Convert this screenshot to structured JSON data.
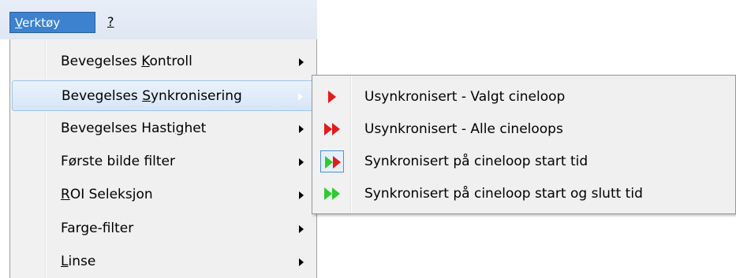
{
  "menubar": {
    "tools_label_prefix": "",
    "tools_label_ul": "V",
    "tools_label_rest": "erktøy",
    "help_label": "?"
  },
  "menu": {
    "items": [
      {
        "pre": "Bevegelses ",
        "ul": "K",
        "post": "ontroll",
        "has_submenu": true,
        "highlighted": false
      },
      {
        "pre": "Bevegelses ",
        "ul": "S",
        "post": "ynkronisering",
        "has_submenu": true,
        "highlighted": true
      },
      {
        "pre": "Bevegelses Hasti",
        "ul": "g",
        "post": "het",
        "has_submenu": true,
        "highlighted": false
      },
      {
        "pre": "Første bilde filter",
        "ul": "",
        "post": "",
        "has_submenu": true,
        "highlighted": false
      },
      {
        "pre": "",
        "ul": "R",
        "post": "OI Seleksjon",
        "has_submenu": true,
        "highlighted": false
      },
      {
        "pre": "Farge-filter",
        "ul": "",
        "post": "",
        "has_submenu": true,
        "highlighted": false
      },
      {
        "pre": "",
        "ul": "L",
        "post": "inse",
        "has_submenu": true,
        "highlighted": false
      }
    ]
  },
  "submenu": {
    "items": [
      {
        "label": "Usynkronisert - Valgt cineloop",
        "icon": "single-red-play-icon",
        "color": "#e31b1b",
        "checked": false
      },
      {
        "label": "Usynkronisert - Alle cineloops",
        "icon": "double-red-play-icon",
        "color": "#e31b1b",
        "checked": false
      },
      {
        "label": "Synkronisert på cineloop start tid",
        "icon": "double-red-green-play-icon",
        "color": "#2ecc2e",
        "checked": true
      },
      {
        "label": "Synkronisert på cineloop start og slutt tid",
        "icon": "double-green-play-icon",
        "color": "#2ecc2e",
        "checked": false
      }
    ]
  },
  "colors": {
    "accent": "#3c82cf",
    "red": "#e31b1b",
    "green": "#22cc22"
  }
}
